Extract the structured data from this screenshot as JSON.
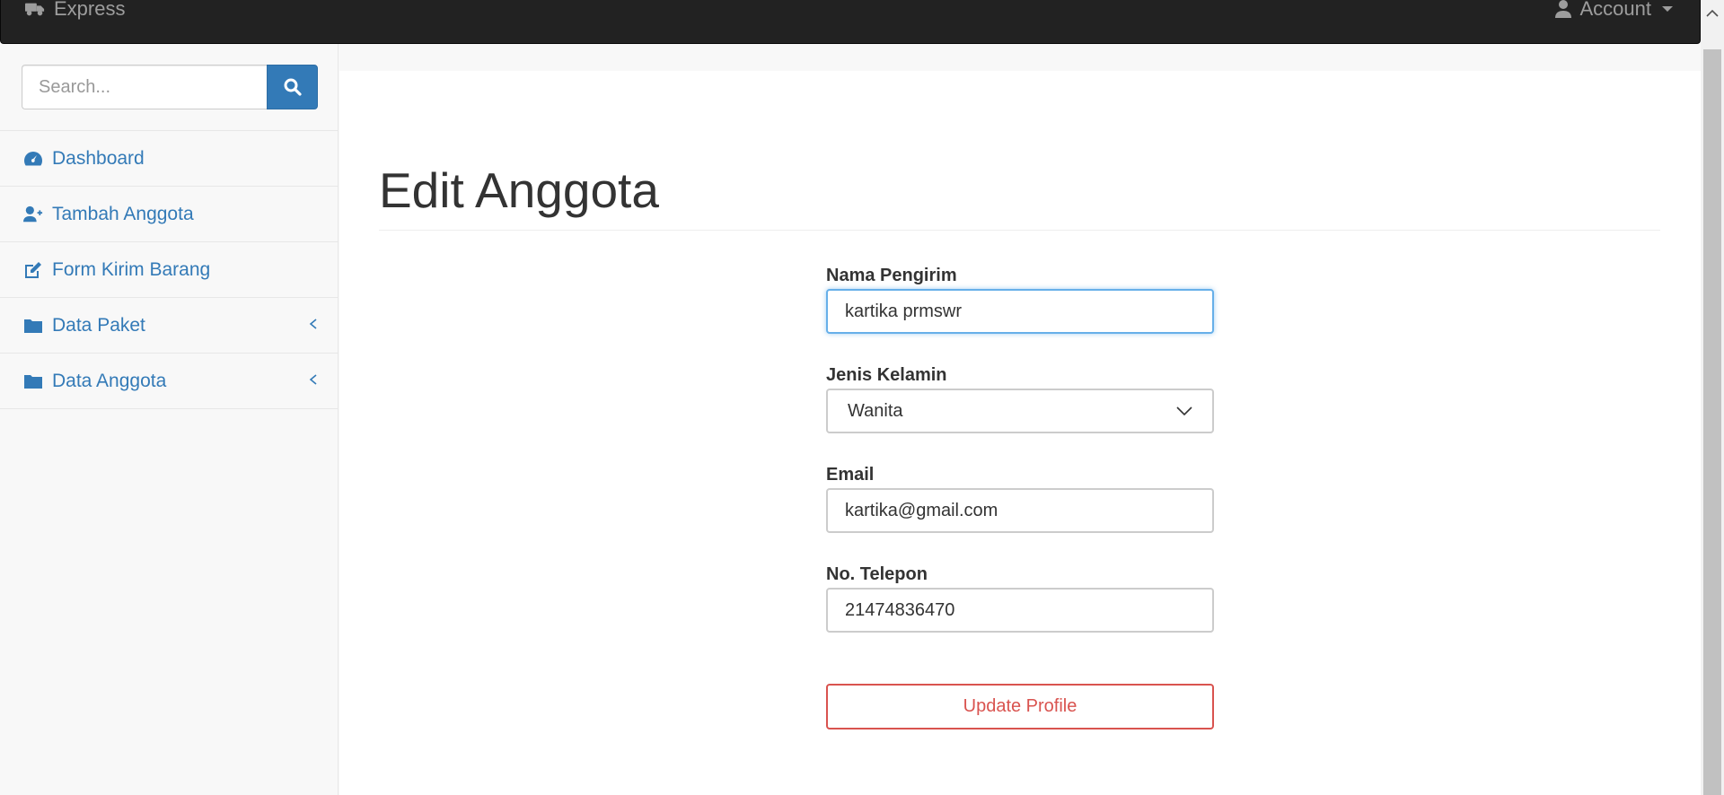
{
  "navbar": {
    "brand": "Express",
    "account_label": "Account"
  },
  "sidebar": {
    "search_placeholder": "Search...",
    "items": [
      {
        "label": "Dashboard",
        "icon": "dashboard-icon"
      },
      {
        "label": "Tambah Anggota",
        "icon": "user-plus-icon"
      },
      {
        "label": "Form Kirim Barang",
        "icon": "edit-icon"
      },
      {
        "label": "Data Paket",
        "icon": "folder-icon",
        "has_submenu": true
      },
      {
        "label": "Data Anggota",
        "icon": "folder-icon",
        "has_submenu": true
      }
    ]
  },
  "main": {
    "title": "Edit Anggota",
    "form": {
      "nama_label": "Nama Pengirim",
      "nama_value": "kartika prmswr",
      "gender_label": "Jenis Kelamin",
      "gender_value": "Wanita",
      "email_label": "Email",
      "email_value": "kartika@gmail.com",
      "phone_label": "No. Telepon",
      "phone_value": "21474836470",
      "submit_label": "Update Profile"
    }
  },
  "colors": {
    "navbar_bg": "#222222",
    "link": "#337ab7",
    "primary_button": "#337ab7",
    "danger": "#d9534f",
    "focus_border": "#66afe9"
  }
}
